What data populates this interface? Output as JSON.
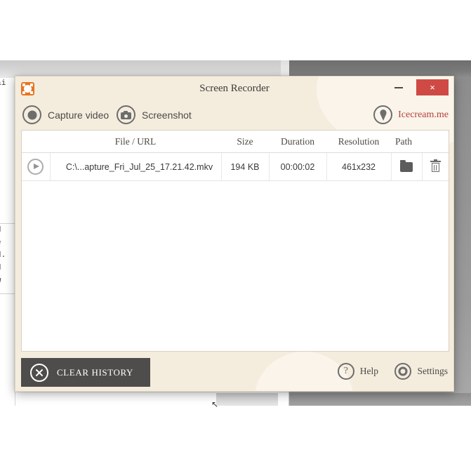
{
  "window": {
    "title": "Screen Recorder",
    "app_icon": "screen-recorder-icon",
    "minimize_label": "–",
    "close_label": "×"
  },
  "toolbar": {
    "capture_video_label": "Capture video",
    "capture_video_icon": "record-circle-icon",
    "screenshot_label": "Screenshot",
    "screenshot_icon": "camera-icon",
    "brand_label": "Icecream.me",
    "brand_icon": "ice-cream-cone-icon",
    "brand_color": "#b6413c"
  },
  "history_table": {
    "columns": [
      "",
      "File / URL",
      "Size",
      "Duration",
      "Resolution",
      "Path",
      ""
    ],
    "rows": [
      {
        "play_icon": "play-icon",
        "file": "C:\\...apture_Fri_Jul_25_17.21.42.mkv",
        "size": "194 KB",
        "duration": "00:00:02",
        "resolution": "461x232",
        "path_icon": "folder-icon",
        "delete_icon": "trash-icon"
      }
    ]
  },
  "footer": {
    "clear_history_label": "CLEAR HISTORY",
    "clear_history_icon": "x-circle-icon",
    "help_label": "Help",
    "help_icon": "question-mark-icon",
    "settings_label": "Settings",
    "settings_icon": "gear-icon"
  },
  "background": {
    "code_lines": [
      "mai",
      "nd",
      "de",
      "dd.",
      "nd",
      "ew"
    ],
    "resize_cursor": "↖"
  }
}
